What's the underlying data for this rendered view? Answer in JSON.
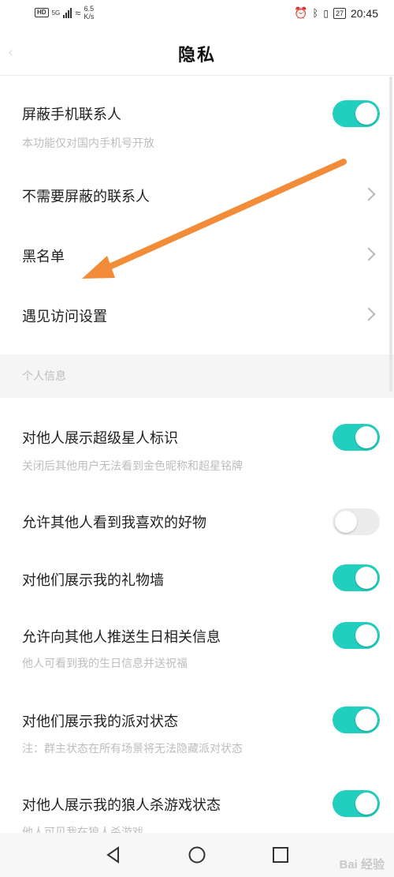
{
  "status_bar": {
    "hd": "HD",
    "network": "5G",
    "speed_value": "6.5",
    "speed_unit": "K/s",
    "battery": "27",
    "time": "20:45"
  },
  "header": {
    "title": "隐私"
  },
  "privacy_items": [
    {
      "label": "屏蔽手机联系人",
      "subtitle": "本功能仅对国内手机号开放",
      "toggle": "on"
    },
    {
      "label": "不需要屏蔽的联系人",
      "chevron": true
    },
    {
      "label": "黑名单",
      "chevron": true
    },
    {
      "label": "遇见访问设置",
      "chevron": true
    }
  ],
  "section": {
    "title": "个人信息"
  },
  "personal_items": [
    {
      "label": "对他人展示超级星人标识",
      "subtitle": "关闭后其他用户无法看到金色昵称和超星铭牌",
      "toggle": "on"
    },
    {
      "label": "允许其他人看到我喜欢的好物",
      "toggle": "off"
    },
    {
      "label": "对他们展示我的礼物墙",
      "toggle": "on"
    },
    {
      "label": "允许向其他人推送生日相关信息",
      "subtitle": "他人可看到我的生日信息并送祝福",
      "toggle": "on"
    },
    {
      "label": "对他们展示我的派对状态",
      "subtitle": "注：群主状态在所有场景将无法隐藏派对状态",
      "toggle": "on"
    },
    {
      "label": "对他人展示我的狼人杀游戏状态",
      "subtitle": "他人可见我在狼人杀游戏",
      "toggle": "on"
    }
  ],
  "watermark": "Bai 经验",
  "colors": {
    "toggle_on": "#22cfbf",
    "toggle_off": "#ececec",
    "annotation_arrow": "#f28c38"
  },
  "icons": [
    "back-icon",
    "chevron-right-icon",
    "nav-back-icon",
    "nav-home-icon",
    "nav-recents-icon"
  ]
}
